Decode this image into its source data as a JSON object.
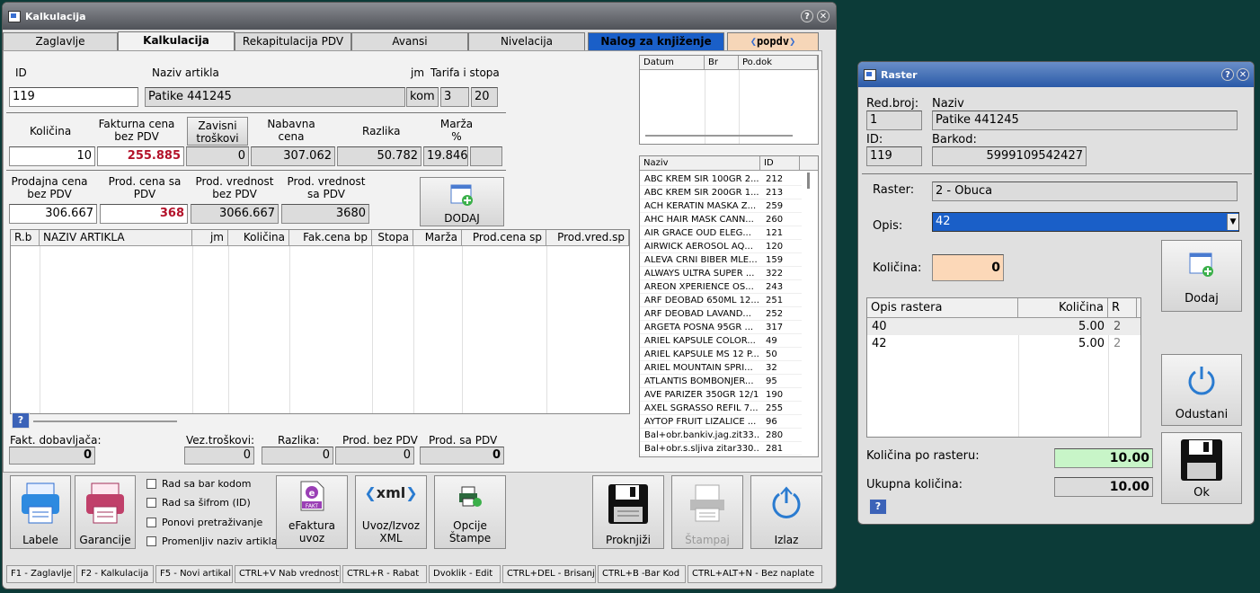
{
  "main_window": {
    "title": "Kalkulacija",
    "tabs": [
      "Zaglavlje",
      "Kalkulacija",
      "Rekapitulacija PDV",
      "Avansi",
      "Nivelacija",
      "Nalog za knjiženje",
      "popdv"
    ],
    "header_labels": {
      "id": "ID",
      "naziv": "Naziv artikla",
      "jm": "jm",
      "tarifa": "Tarifa i stopa"
    },
    "header_values": {
      "id": "119",
      "naziv": "Patike 441245",
      "jm": "kom",
      "tarifa": "3",
      "stopa": "20"
    },
    "calc_labels": {
      "kolicina": "Količina",
      "fakturna": "Fakturna cena\nbez PDV",
      "zavisni": "Zavisni\ntroškovi",
      "nabavna": "Nabavna\ncena",
      "razlika": "Razlika",
      "marza": "Marža\n%"
    },
    "calc_values": {
      "kolicina": "10",
      "fakturna": "255.885",
      "zavisni": "0",
      "nabavna": "307.062",
      "razlika": "50.782",
      "marza": "19.846"
    },
    "prod_labels": {
      "prodajna": "Prodajna cena\nbez PDV",
      "prod_sa": "Prod. cena sa\nPDV",
      "vred_bez": "Prod. vrednost\nbez PDV",
      "vred_sa": "Prod. vrednost\nsa PDV"
    },
    "prod_values": {
      "prodajna": "306.667",
      "prod_sa": "368",
      "vred_bez": "3066.667",
      "vred_sa": "3680"
    },
    "dodaj_label": "DODAJ",
    "items_columns": [
      "R.b",
      "NAZIV ARTIKLA",
      "jm",
      "Količina",
      "Fak.cena bp",
      "Stopa",
      "Marža",
      "Prod.cena sp",
      "Prod.vred.sp"
    ],
    "doc_columns": [
      "Datum",
      "Br",
      "Po.dok"
    ],
    "article_columns": [
      "Naziv",
      "ID"
    ],
    "articles": [
      {
        "naziv": "ABC KREM SIR 100GR 2...",
        "id": "212"
      },
      {
        "naziv": "ABC KREM SIR 200GR 1...",
        "id": "213"
      },
      {
        "naziv": "ACH KERATIN MASKA Z...",
        "id": "259"
      },
      {
        "naziv": "AHC HAIR MASK CANN...",
        "id": "260"
      },
      {
        "naziv": "AIR GRACE OUD ELEG...",
        "id": "121"
      },
      {
        "naziv": "AIRWICK AEROSOL AQ...",
        "id": "120"
      },
      {
        "naziv": "ALEVA CRNI BIBER MLE...",
        "id": "159"
      },
      {
        "naziv": "ALWAYS ULTRA SUPER ...",
        "id": "322"
      },
      {
        "naziv": "AREON XPERIENCE OS...",
        "id": "243"
      },
      {
        "naziv": "ARF DEOBAD 650ML 12...",
        "id": "251"
      },
      {
        "naziv": "ARF DEOBAD LAVAND...",
        "id": "252"
      },
      {
        "naziv": "ARGETA POSNA 95GR ...",
        "id": "317"
      },
      {
        "naziv": "ARIEL KAPSULE COLOR...",
        "id": "49"
      },
      {
        "naziv": "ARIEL KAPSULE MS 12 P...",
        "id": "50"
      },
      {
        "naziv": "ARIEL MOUNTAIN SPRI...",
        "id": "32"
      },
      {
        "naziv": "ATLANTIS BOMBONJER...",
        "id": "95"
      },
      {
        "naziv": "AVE PARIZER 350GR 12/1",
        "id": "190"
      },
      {
        "naziv": "AXEL SGRASSO REFIL 7...",
        "id": "255"
      },
      {
        "naziv": "AYTOP FRUIT LIZALICE ...",
        "id": "96"
      },
      {
        "naziv": "Bal+obr.bankiv.jag.zit33...",
        "id": "280"
      },
      {
        "naziv": "Bal+obr.s.sljiva zitar330...",
        "id": "281"
      }
    ],
    "totals_labels": {
      "fakt": "Fakt. dobavljača:",
      "vez": "Vez.troškovi:",
      "razlika": "Razlika:",
      "bez": "Prod. bez PDV",
      "sa": "Prod. sa PDV"
    },
    "totals_values": {
      "fakt": "0",
      "vez": "0",
      "razlika": "0",
      "bez": "0",
      "sa": "0"
    },
    "checkboxes": [
      "Rad sa bar kodom",
      "Rad sa šifrom (ID)",
      "Ponovi pretraživanje",
      "Promenljiv naziv artikla"
    ],
    "buttons": {
      "labele": "Labele",
      "garancije": "Garancije",
      "efaktura": "eFaktura\nuvoz",
      "xml": "Uvoz/Izvoz\nXML",
      "opcije": "Opcije\nŠtampe",
      "proknjizi": "Proknjiži",
      "stampaj": "Štampaj",
      "izlaz": "Izlaz",
      "efakt_badge": "FAKT",
      "xml_icon": "xml"
    },
    "status": [
      "F1 - Zaglavlje",
      "F2 - Kalkulacija",
      "F5 - Novi artikal",
      "CTRL+V Nab vrednost",
      "CTRL+R - Rabat",
      "Dvoklik - Edit",
      "CTRL+DEL - Brisanje",
      "CTRL+B -Bar Kod",
      "CTRL+ALT+N - Bez naplate"
    ],
    "help": "?"
  },
  "raster_window": {
    "title": "Raster",
    "labels": {
      "redbroj": "Red.broj:",
      "naziv": "Naziv",
      "id": "ID:",
      "barkod": "Barkod:",
      "raster": "Raster:",
      "opis": "Opis:",
      "kolicina": "Količina:"
    },
    "values": {
      "redbroj": "1",
      "naziv": "Patike 441245",
      "id": "119",
      "barkod": "5999109542427",
      "raster": "2 - Obuca",
      "opis": "42",
      "kolicina": "0"
    },
    "grid_columns": [
      "Opis rastera",
      "Količina",
      "R"
    ],
    "grid_rows": [
      {
        "opis": "40",
        "kolicina": "5.00",
        "r": "2"
      },
      {
        "opis": "42",
        "kolicina": "5.00",
        "r": "2"
      }
    ],
    "buttons": {
      "dodaj": "Dodaj",
      "odustani": "Odustani",
      "ok": "Ok"
    },
    "summary_labels": {
      "po_rasteru": "Količina po rasteru:",
      "ukupna": "Ukupna količina:"
    },
    "summary_values": {
      "po_rasteru": "10.00",
      "ukupna": "10.00"
    },
    "help": "?"
  },
  "colors": {
    "desktop": "#0c3b38",
    "nalog_tab": "#1a5fc8",
    "popdv_tab": "#f6d6b8",
    "accent_red": "#b3122a",
    "selection": "#1a5fc8",
    "kolicina_bg": "#fcd8b8",
    "summary_green": "#c8f5c8"
  }
}
